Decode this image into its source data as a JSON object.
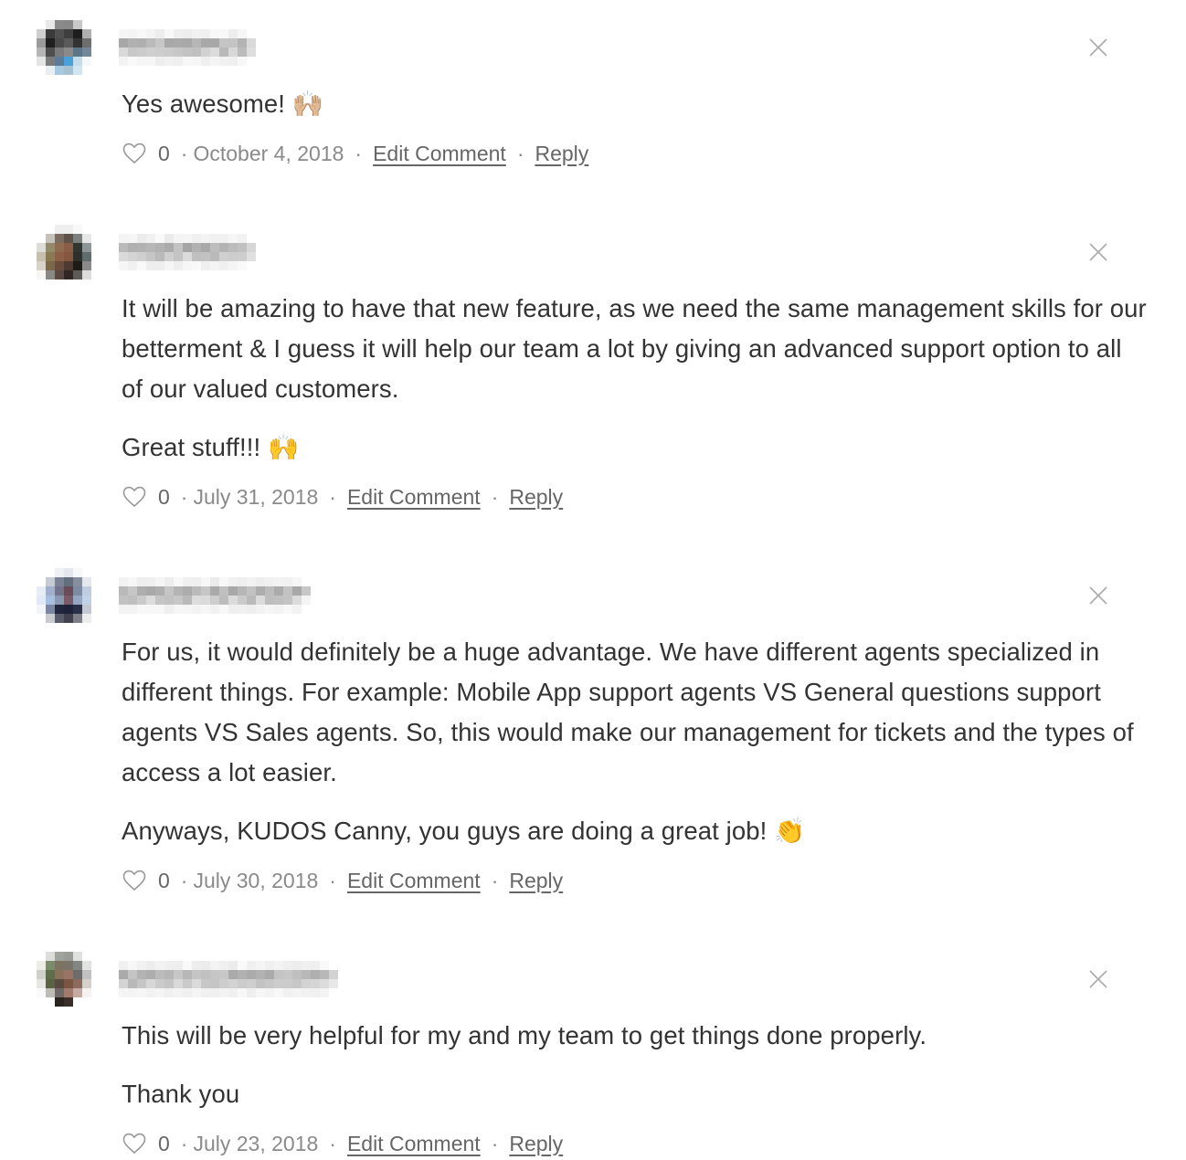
{
  "comments": [
    {
      "author": "[blurred name]",
      "paragraphs": [
        "Yes awesome! 🙌🏼"
      ],
      "likes": "0",
      "date": "October 4, 2018",
      "edit_label": "Edit Comment",
      "reply_label": "Reply",
      "avatar_colors": [
        "#ffffff",
        "#e8e8e8",
        "#8a8a8a",
        "#888888",
        "#c8c8c8",
        "#ffffff",
        "#cfcfcf",
        "#3a3a3a",
        "#505050",
        "#3f3f3f",
        "#1e1e1e",
        "#b0b0b0",
        "#9a9a9a",
        "#1f1f1f",
        "#4a4a4a",
        "#5a5a5a",
        "#333333",
        "#6e6e6e",
        "#b5b5b5",
        "#4f4f4f",
        "#7a7a7a",
        "#8a8a8a",
        "#5c7488",
        "#72889a",
        "#e4e4e4",
        "#7b7b7b",
        "#5d7a96",
        "#4aa0d8",
        "#c2dcea",
        "#f4f8fa",
        "#ffffff",
        "#e8eef2",
        "#a8c8de",
        "#a6c2d2",
        "#d0e6f2",
        "#ffffff"
      ]
    },
    {
      "author": "[blurred name]",
      "paragraphs": [
        "It will be amazing to have that new feature, as we need the same management skills for our betterment & I guess it will help our team a lot by giving an advanced support option to all of our valued customers.",
        "Great stuff!!! 🙌"
      ],
      "likes": "0",
      "date": "July 31, 2018",
      "edit_label": "Edit Comment",
      "reply_label": "Reply",
      "avatar_colors": [
        "#ffffff",
        "#ffffff",
        "#eeeeee",
        "#eeeeee",
        "#f8f8f8",
        "#ffffff",
        "#ffffff",
        "#c5c2bb",
        "#7a6c60",
        "#5e5249",
        "#7c807f",
        "#e6e8e8",
        "#dedcd8",
        "#938a6c",
        "#8f6c50",
        "#8a5e44",
        "#313631",
        "#8c9696",
        "#c6bfae",
        "#8a7a54",
        "#8c6048",
        "#86563e",
        "#2e302c",
        "#5f6c6e",
        "#d8d2c8",
        "#7a6848",
        "#6a4c3c",
        "#4e3a30",
        "#1e1a16",
        "#8a8a8a",
        "#f8f6f2",
        "#888884",
        "#584840",
        "#302624",
        "#5e5a58",
        "#dcdcdc"
      ]
    },
    {
      "author": "[blurred name]",
      "paragraphs": [
        "For us, it would definitely be a huge advantage. We have different agents specialized in different things. For example: Mobile App support agents VS General questions support agents VS Sales agents. So, this would make our management for tickets and the types of access a lot easier.",
        "Anyways, KUDOS Canny, you guys are doing a great job! 👏"
      ],
      "likes": "0",
      "date": "July 30, 2018",
      "edit_label": "Edit Comment",
      "reply_label": "Reply",
      "avatar_colors": [
        "#ffffff",
        "#ffffff",
        "#eef0f4",
        "#e2e8ee",
        "#f6f8fa",
        "#ffffff",
        "#ffffff",
        "#c6cad2",
        "#7a8294",
        "#62707e",
        "#868ea0",
        "#e6e8f0",
        "#e8ecf4",
        "#a0b0ca",
        "#72748c",
        "#6a4c58",
        "#7c8aa2",
        "#c0cce0",
        "#e2e8f4",
        "#a8c0e0",
        "#8a98b2",
        "#7a5a66",
        "#94a8c4",
        "#c2d2e6",
        "#f2f4f8",
        "#7a86a2",
        "#20263e",
        "#1e223a",
        "#2a3048",
        "#c4c8d2",
        "#ffffff",
        "#c8cad0",
        "#5a5c6a",
        "#40404e",
        "#7e8088",
        "#ececee"
      ]
    },
    {
      "author": "[blurred name]",
      "paragraphs": [
        "This will be very helpful for my and my team to get things done properly.",
        "Thank you"
      ],
      "likes": "0",
      "date": "July 23, 2018",
      "edit_label": "Edit Comment",
      "reply_label": "Reply",
      "avatar_colors": [
        "#ffffff",
        "#dcdcda",
        "#a0a29e",
        "#9a9c98",
        "#e0e0e0",
        "#ffffff",
        "#ecece8",
        "#7a8c6a",
        "#7c7460",
        "#7a7468",
        "#848684",
        "#e2e2e2",
        "#d0d0ca",
        "#5e6e4a",
        "#88725c",
        "#9a7464",
        "#6e6c6a",
        "#c0c0c0",
        "#e6e6e2",
        "#5a6444",
        "#584c40",
        "#7c5444",
        "#8c6a5e",
        "#d6d0cc",
        "#fafafa",
        "#bebcb6",
        "#6e6866",
        "#a07a6c",
        "#c4aaa0",
        "#f6f2f0",
        "#ffffff",
        "#ffffff",
        "#2a2420",
        "#3a2e28",
        "#ffffff",
        "#ffffff"
      ]
    }
  ],
  "icons": {
    "like": "heart-outline-icon",
    "close": "close-x-icon"
  },
  "colors": {
    "body_text": "#333333",
    "meta_text": "#8a8a8a",
    "link_text": "#666666",
    "icon_gray": "#aaaaaa"
  }
}
